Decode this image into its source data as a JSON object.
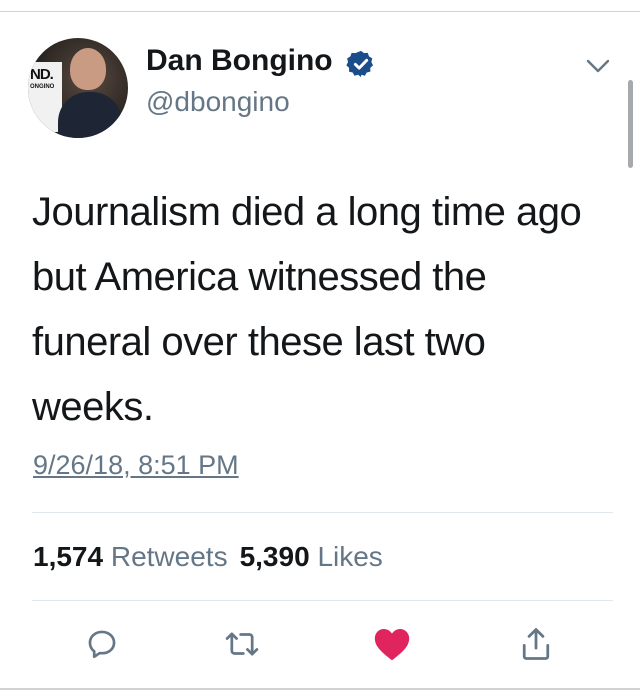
{
  "tweet": {
    "author": {
      "display_name": "Dan Bongino",
      "handle": "@dbongino",
      "verified_icon": "verified-badge-icon",
      "avatar_banner_text": "ND.",
      "avatar_banner_subtext": "ONGINO"
    },
    "text": "Journalism died a long time ago but America witnessed the funeral over these last two weeks.",
    "timestamp": "9/26/18, 8:51 PM",
    "stats": {
      "retweets_count": "1,574",
      "retweets_label": "Retweets",
      "likes_count": "5,390",
      "likes_label": "Likes"
    },
    "actions": {
      "reply_icon": "reply-icon",
      "retweet_icon": "retweet-icon",
      "like_icon": "heart-icon",
      "share_icon": "share-icon"
    },
    "menu_icon": "chevron-down-icon"
  },
  "colors": {
    "verified": "#1da1f2",
    "verified_dark": "#1b4d8a",
    "secondary_text": "#657786",
    "icon_gray": "#657786",
    "like_red": "#e0245e"
  }
}
